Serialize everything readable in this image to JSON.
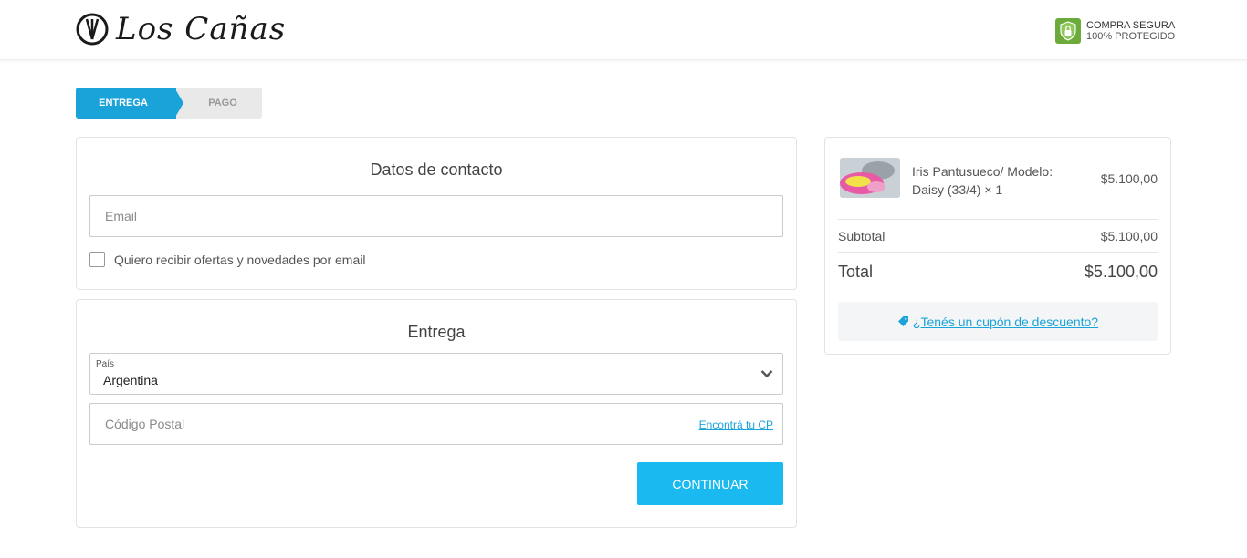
{
  "header": {
    "logo_text": "Los Cañas",
    "secure_line1": "COMPRA SEGURA",
    "secure_line2": "100% PROTEGIDO"
  },
  "steps": {
    "active": "ENTREGA",
    "inactive": "PAGO"
  },
  "contact": {
    "title": "Datos de contacto",
    "email_placeholder": "Email",
    "newsletter_label": "Quiero recibir ofertas y novedades por email",
    "newsletter_checked": false
  },
  "delivery": {
    "title": "Entrega",
    "country_label": "País",
    "country_value": "Argentina",
    "postal_placeholder": "Código Postal",
    "find_cp_link": "Encontrá tu CP",
    "continue_button": "CONTINUAR"
  },
  "summary": {
    "product_name": "Iris Pantusueco/ Modelo: Daisy (33/4) × 1",
    "product_price": "$5.100,00",
    "subtotal_label": "Subtotal",
    "subtotal_value": "$5.100,00",
    "total_label": "Total",
    "total_value": "$5.100,00",
    "coupon_link": "¿Tenés un cupón de descuento?"
  },
  "colors": {
    "accent": "#1aa3d9",
    "button": "#1ab9f0",
    "secure_green": "#6cab3b"
  },
  "icons": [
    "logo-mark-icon",
    "shield-lock-icon",
    "chevron-down-icon",
    "tag-icon"
  ]
}
